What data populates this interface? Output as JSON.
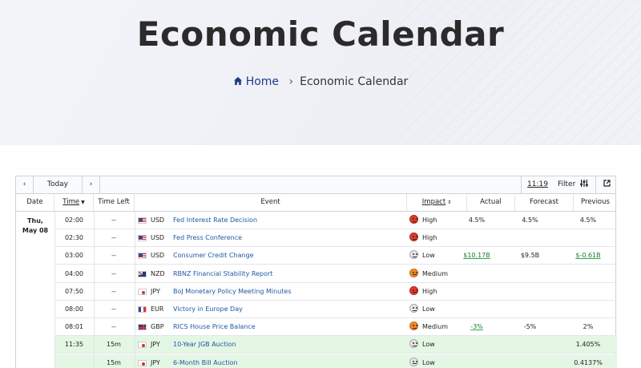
{
  "hero": {
    "title": "Economic Calendar",
    "breadcrumb_home": "Home",
    "breadcrumb_sep": "›",
    "breadcrumb_current": "Economic Calendar"
  },
  "toolbar": {
    "prev": "‹",
    "today": "Today",
    "next": "›",
    "time": "11:19",
    "filter": "Filter",
    "filter_icon": "sliders-icon",
    "external_icon": "external-link-icon"
  },
  "columns": {
    "date": "Date",
    "time": "Time",
    "time_left": "Time Left",
    "event": "Event",
    "impact": "Impact",
    "actual": "Actual",
    "forecast": "Forecast",
    "previous": "Previous"
  },
  "date_group": {
    "day": "Thu,",
    "date": "May 08"
  },
  "impact_colors": {
    "High": "#e23a2a",
    "Medium": "#f08a2a",
    "Low": "#e6e6e6"
  },
  "highlight_color": "#e4f6e4",
  "rows": [
    {
      "time": "02:00",
      "left": "--",
      "currency": "USD",
      "event": "Fed Interest Rate Decision",
      "impact": "High",
      "actual": "4.5%",
      "forecast": "4.5%",
      "previous": "4.5%"
    },
    {
      "time": "02:30",
      "left": "--",
      "currency": "USD",
      "event": "Fed Press Conference",
      "impact": "High",
      "actual": "",
      "forecast": "",
      "previous": ""
    },
    {
      "time": "03:00",
      "left": "--",
      "currency": "USD",
      "event": "Consumer Credit Change",
      "impact": "Low",
      "actual": "$10.17B",
      "forecast": "$9.5B",
      "previous": "$-0.61B"
    },
    {
      "time": "04:00",
      "left": "--",
      "currency": "NZD",
      "event": "RBNZ Financial Stability Report",
      "impact": "Medium",
      "actual": "",
      "forecast": "",
      "previous": ""
    },
    {
      "time": "07:50",
      "left": "--",
      "currency": "JPY",
      "event": "BoJ Monetary Policy Meeting Minutes",
      "impact": "High",
      "actual": "",
      "forecast": "",
      "previous": ""
    },
    {
      "time": "08:00",
      "left": "--",
      "currency": "EUR",
      "event": "Victory in Europe Day",
      "impact": "Low",
      "actual": "",
      "forecast": "",
      "previous": ""
    },
    {
      "time": "08:01",
      "left": "--",
      "currency": "GBP",
      "event": "RICS House Price Balance",
      "impact": "Medium",
      "actual": "-3%",
      "forecast": "-5%",
      "previous": "2%"
    },
    {
      "time": "11:35",
      "left": "15m",
      "currency": "JPY",
      "event": "10-Year JGB Auction",
      "impact": "Low",
      "actual": "",
      "forecast": "",
      "previous": "1.405%"
    },
    {
      "time": "",
      "left": "15m",
      "currency": "JPY",
      "event": "6-Month Bill Auction",
      "impact": "Low",
      "actual": "",
      "forecast": "",
      "previous": "0.4137%"
    }
  ]
}
